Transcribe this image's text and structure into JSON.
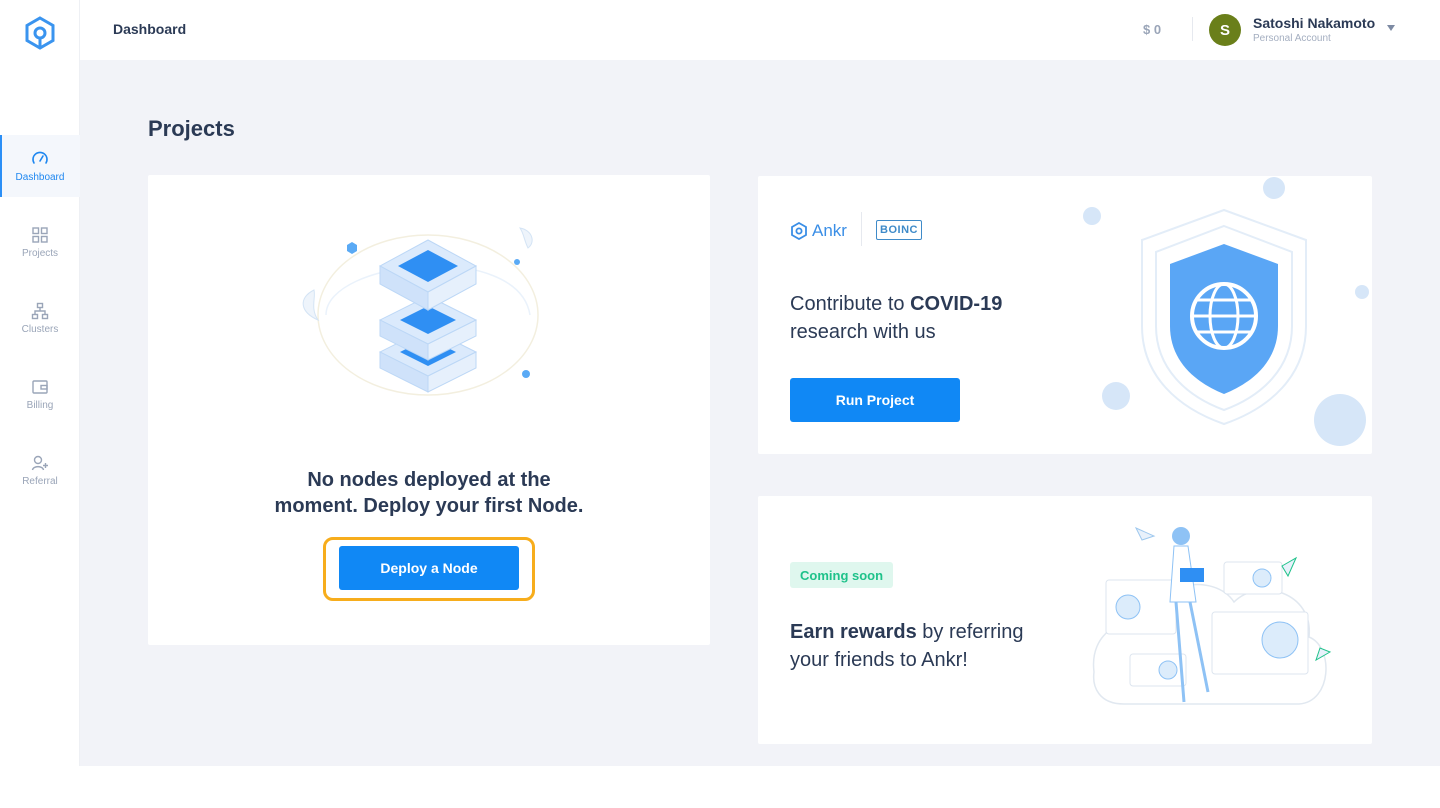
{
  "header": {
    "breadcrumb": "Dashboard",
    "balance": "$ 0",
    "user": {
      "initial": "S",
      "name": "Satoshi Nakamoto",
      "account_type": "Personal Account",
      "avatar_color": "#6a7f1a"
    }
  },
  "sidebar": {
    "items": [
      {
        "label": "Dashboard",
        "icon": "speedometer-icon",
        "active": true
      },
      {
        "label": "Projects",
        "icon": "grid-icon",
        "active": false
      },
      {
        "label": "Clusters",
        "icon": "hierarchy-icon",
        "active": false
      },
      {
        "label": "Billing",
        "icon": "wallet-icon",
        "active": false
      },
      {
        "label": "Referral",
        "icon": "add-user-icon",
        "active": false
      }
    ]
  },
  "main": {
    "title": "Projects",
    "nodes_card": {
      "line1": "No nodes deployed at the",
      "line2": "moment. Deploy your first Node.",
      "button": "Deploy a Node"
    },
    "covid_card": {
      "ankr_logo": "Ankr",
      "boinc_logo": "BOINC",
      "text_prefix": "Contribute to ",
      "text_bold": "COVID-19",
      "text_line2": "research with us",
      "button": "Run Project"
    },
    "referral_card": {
      "badge": "Coming soon",
      "text_bold": "Earn rewards",
      "text_rest": " by referring",
      "text_line2": "your friends to Ankr!"
    }
  },
  "colors": {
    "accent": "#1088f5",
    "highlight_outline": "#f7ad1c",
    "badge_bg": "#dff7ee",
    "badge_text": "#1fc28a",
    "background": "#f2f3f8"
  }
}
